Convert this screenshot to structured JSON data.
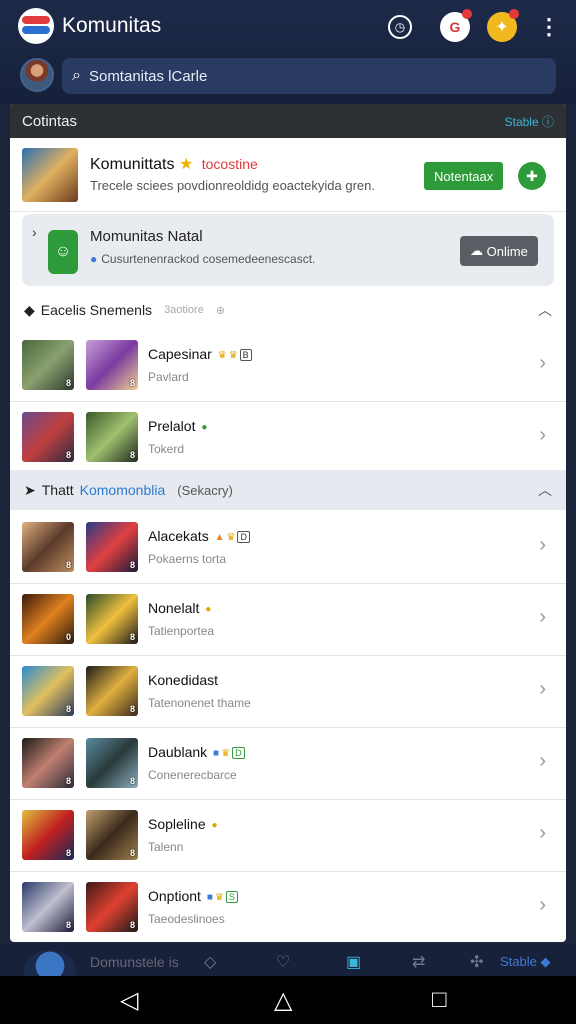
{
  "app": {
    "title": "Komunitas",
    "search_placeholder": "Somtanitas lCarle"
  },
  "panel": {
    "header": "Cotintas",
    "stable": "Stable"
  },
  "featured": {
    "title": "Komunittats",
    "online": "tocostine",
    "desc": "Trecele sciees povdionreoldidg eoactekyida gren.",
    "button": "Notentaax"
  },
  "notice": {
    "title": "Momunitas Natal",
    "desc": "Cusurtenenrackod cosemedeenescasct.",
    "button": "Onlime"
  },
  "sections": [
    {
      "title": "Eacelis Snemenls",
      "muted": "3aotiore"
    },
    {
      "title_prefix": "Thatt",
      "title_blue": "Komomonblia",
      "title_suffix": "(Sekacry)"
    }
  ],
  "rows": [
    {
      "title": "Capesinar",
      "sub": "Pavlard"
    },
    {
      "title": "Prelalot",
      "sub": "Tokerd"
    },
    {
      "title": "Alacekats",
      "sub": "Pokaerns torta"
    },
    {
      "title": "Nonelalt",
      "sub": "Tatienportea"
    },
    {
      "title": "Konedidast",
      "sub": "Tatenonenet thame"
    },
    {
      "title": "Daublank",
      "sub": "Conenerecbarce"
    },
    {
      "title": "Sopleline",
      "sub": "Talenn"
    },
    {
      "title": "Onptiont",
      "sub": "Taeodeslinoes"
    }
  ],
  "thumb_badges": [
    [
      "8",
      "8"
    ],
    [
      "8",
      "8"
    ],
    [
      "8",
      "8"
    ],
    [
      "0",
      "8"
    ],
    [
      "8",
      "8"
    ],
    [
      "8",
      "8"
    ],
    [
      "8",
      "8"
    ],
    [
      "8",
      "8"
    ]
  ],
  "tabbar": {
    "label": "Domunstele is",
    "stable": "Stable"
  },
  "colors": {
    "accent_green": "#2e9b3a",
    "header_bg": "#1d2a48",
    "link_blue": "#2a7bd0"
  }
}
